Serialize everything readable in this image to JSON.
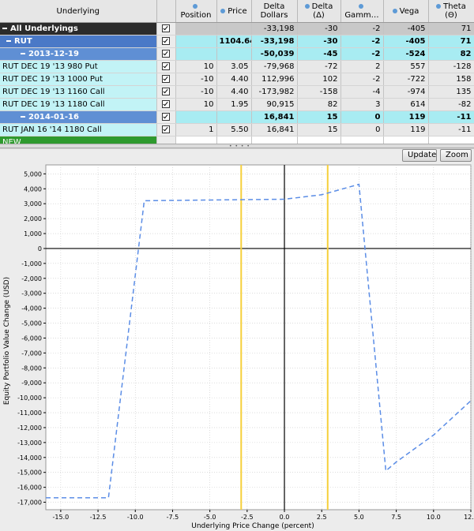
{
  "table": {
    "headers": [
      {
        "label": "Underlying",
        "dot": false
      },
      {
        "label": "",
        "dot": false
      },
      {
        "label": "Position",
        "dot": true
      },
      {
        "label": "Price",
        "dot": true
      },
      {
        "label": "Delta Dollars",
        "dot": false
      },
      {
        "label": "Delta (Δ)",
        "dot": true
      },
      {
        "label": "Gamm…",
        "dot": true
      },
      {
        "label": "Vega",
        "dot": true
      },
      {
        "label": "Theta (Θ)",
        "dot": true
      }
    ],
    "rows": [
      {
        "type": "all",
        "name": "All Underlyings",
        "position": "",
        "price": "",
        "delta_dollars": "-33,198",
        "delta": "-30",
        "gamma": "-2",
        "vega": "-405",
        "theta": "71"
      },
      {
        "type": "rut",
        "name": "RUT",
        "position": "",
        "price": "1104.64",
        "delta_dollars": "-33,198",
        "delta": "-30",
        "gamma": "-2",
        "vega": "-405",
        "theta": "71"
      },
      {
        "type": "exp",
        "name": "2013-12-19",
        "position": "",
        "price": "",
        "delta_dollars": "-50,039",
        "delta": "-45",
        "gamma": "-2",
        "vega": "-524",
        "theta": "82"
      },
      {
        "type": "leg",
        "name": "RUT DEC 19 '13 980 Put",
        "position": "10",
        "price": "3.05",
        "delta_dollars": "-79,968",
        "delta": "-72",
        "gamma": "2",
        "vega": "557",
        "theta": "-128"
      },
      {
        "type": "leg",
        "name": "RUT DEC 19 '13 1000 Put",
        "position": "-10",
        "price": "4.40",
        "delta_dollars": "112,996",
        "delta": "102",
        "gamma": "-2",
        "vega": "-722",
        "theta": "158"
      },
      {
        "type": "leg",
        "name": "RUT DEC 19 '13 1160 Call",
        "position": "-10",
        "price": "4.40",
        "delta_dollars": "-173,982",
        "delta": "-158",
        "gamma": "-4",
        "vega": "-974",
        "theta": "135"
      },
      {
        "type": "leg",
        "name": "RUT DEC 19 '13 1180 Call",
        "position": "10",
        "price": "1.95",
        "delta_dollars": "90,915",
        "delta": "82",
        "gamma": "3",
        "vega": "614",
        "theta": "-82"
      },
      {
        "type": "exp",
        "name": "2014-01-16",
        "position": "",
        "price": "",
        "delta_dollars": "16,841",
        "delta": "15",
        "gamma": "0",
        "vega": "119",
        "theta": "-11"
      },
      {
        "type": "leg",
        "name": "RUT JAN 16 '14 1180 Call",
        "position": "1",
        "price": "5.50",
        "delta_dollars": "16,841",
        "delta": "15",
        "gamma": "0",
        "vega": "119",
        "theta": "-11"
      },
      {
        "type": "new",
        "name": "NEW",
        "position": "",
        "price": "",
        "delta_dollars": "",
        "delta": "",
        "gamma": "",
        "vega": "",
        "theta": ""
      }
    ]
  },
  "toolbar": {
    "update_label": "Update",
    "zoom_label": "Zoom"
  },
  "colors": {
    "curve": "#5b8de6",
    "marker": "#f6cf3a",
    "zero_line": "#000000",
    "grid": "#c8c8c8"
  },
  "chart_data": {
    "type": "line",
    "xlabel": "Underlying Price Change (percent)",
    "ylabel": "Equity Portfolio Value Change (USD)",
    "xlim": [
      -16,
      12.5
    ],
    "ylim": [
      -17500,
      5600
    ],
    "xticks": [
      -15,
      -12.5,
      -10,
      -7.5,
      -5,
      -2.5,
      0,
      2.5,
      5,
      7.5,
      10,
      12.5
    ],
    "xtick_labels": [
      "-15.0",
      "-12.5",
      "-10.0",
      "-7.5",
      "-5.0",
      "-2.5",
      "0.0",
      "2.5",
      "5.0",
      "7.5",
      "10.0",
      "12.5"
    ],
    "yticks": [
      5000,
      4000,
      3000,
      2000,
      1000,
      0,
      -1000,
      -2000,
      -3000,
      -4000,
      -5000,
      -6000,
      -7000,
      -8000,
      -9000,
      -10000,
      -11000,
      -12000,
      -13000,
      -14000,
      -15000,
      -16000,
      -17000
    ],
    "ytick_labels": [
      "5,000",
      "4,000",
      "3,000",
      "2,000",
      "1,000",
      "0",
      "-1,000",
      "-2,000",
      "-3,000",
      "-4,000",
      "-5,000",
      "-6,000",
      "-7,000",
      "-8,000",
      "-9,000",
      "-10,000",
      "-11,000",
      "-12,000",
      "-13,000",
      "-14,000",
      "-15,000",
      "-16,000",
      "-17,000"
    ],
    "grid": true,
    "line_style": "dashed",
    "series": [
      {
        "x": [
          -16,
          -11.8,
          -9.4,
          -5,
          0,
          2.5,
          5,
          6.8,
          7.5,
          10,
          12.5
        ],
        "y": [
          -16700,
          -16700,
          3200,
          3250,
          3300,
          3600,
          4300,
          -14900,
          -14300,
          -12500,
          -10200
        ]
      }
    ],
    "vlines": [
      -2.9,
      2.9
    ]
  }
}
